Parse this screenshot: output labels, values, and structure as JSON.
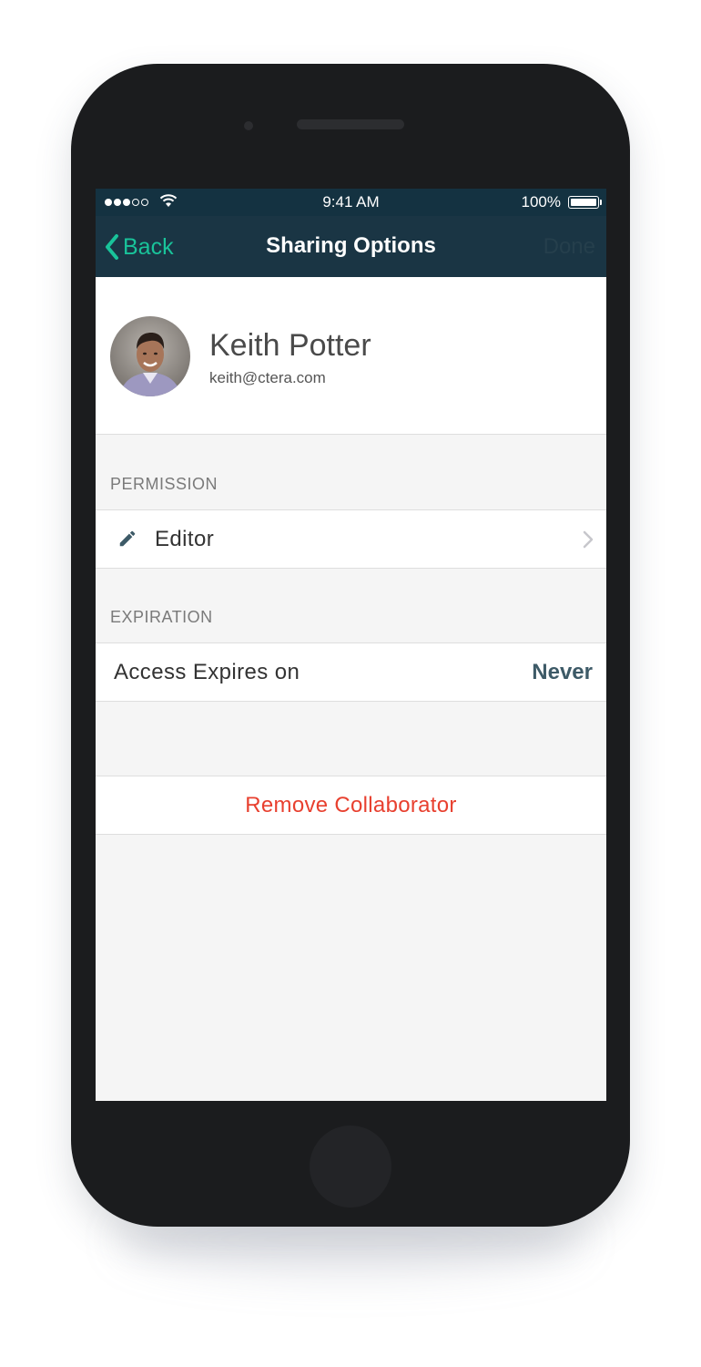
{
  "status_bar": {
    "time": "9:41 AM",
    "battery_percent": "100%",
    "signal_strength": 3,
    "signal_max": 5
  },
  "nav": {
    "back_label": "Back",
    "title": "Sharing Options",
    "done_label": "Done"
  },
  "collaborator": {
    "name": "Keith Potter",
    "email": "keith@ctera.com"
  },
  "permission": {
    "header": "PERMISSION",
    "value": "Editor"
  },
  "expiration": {
    "header": "EXPIRATION",
    "label": "Access Expires on",
    "value": "Never"
  },
  "actions": {
    "remove_label": "Remove Collaborator"
  },
  "colors": {
    "accent": "#19c39a",
    "nav_background": "#1a3544",
    "destructive": "#e8402f",
    "value_text": "#3d5a67"
  }
}
